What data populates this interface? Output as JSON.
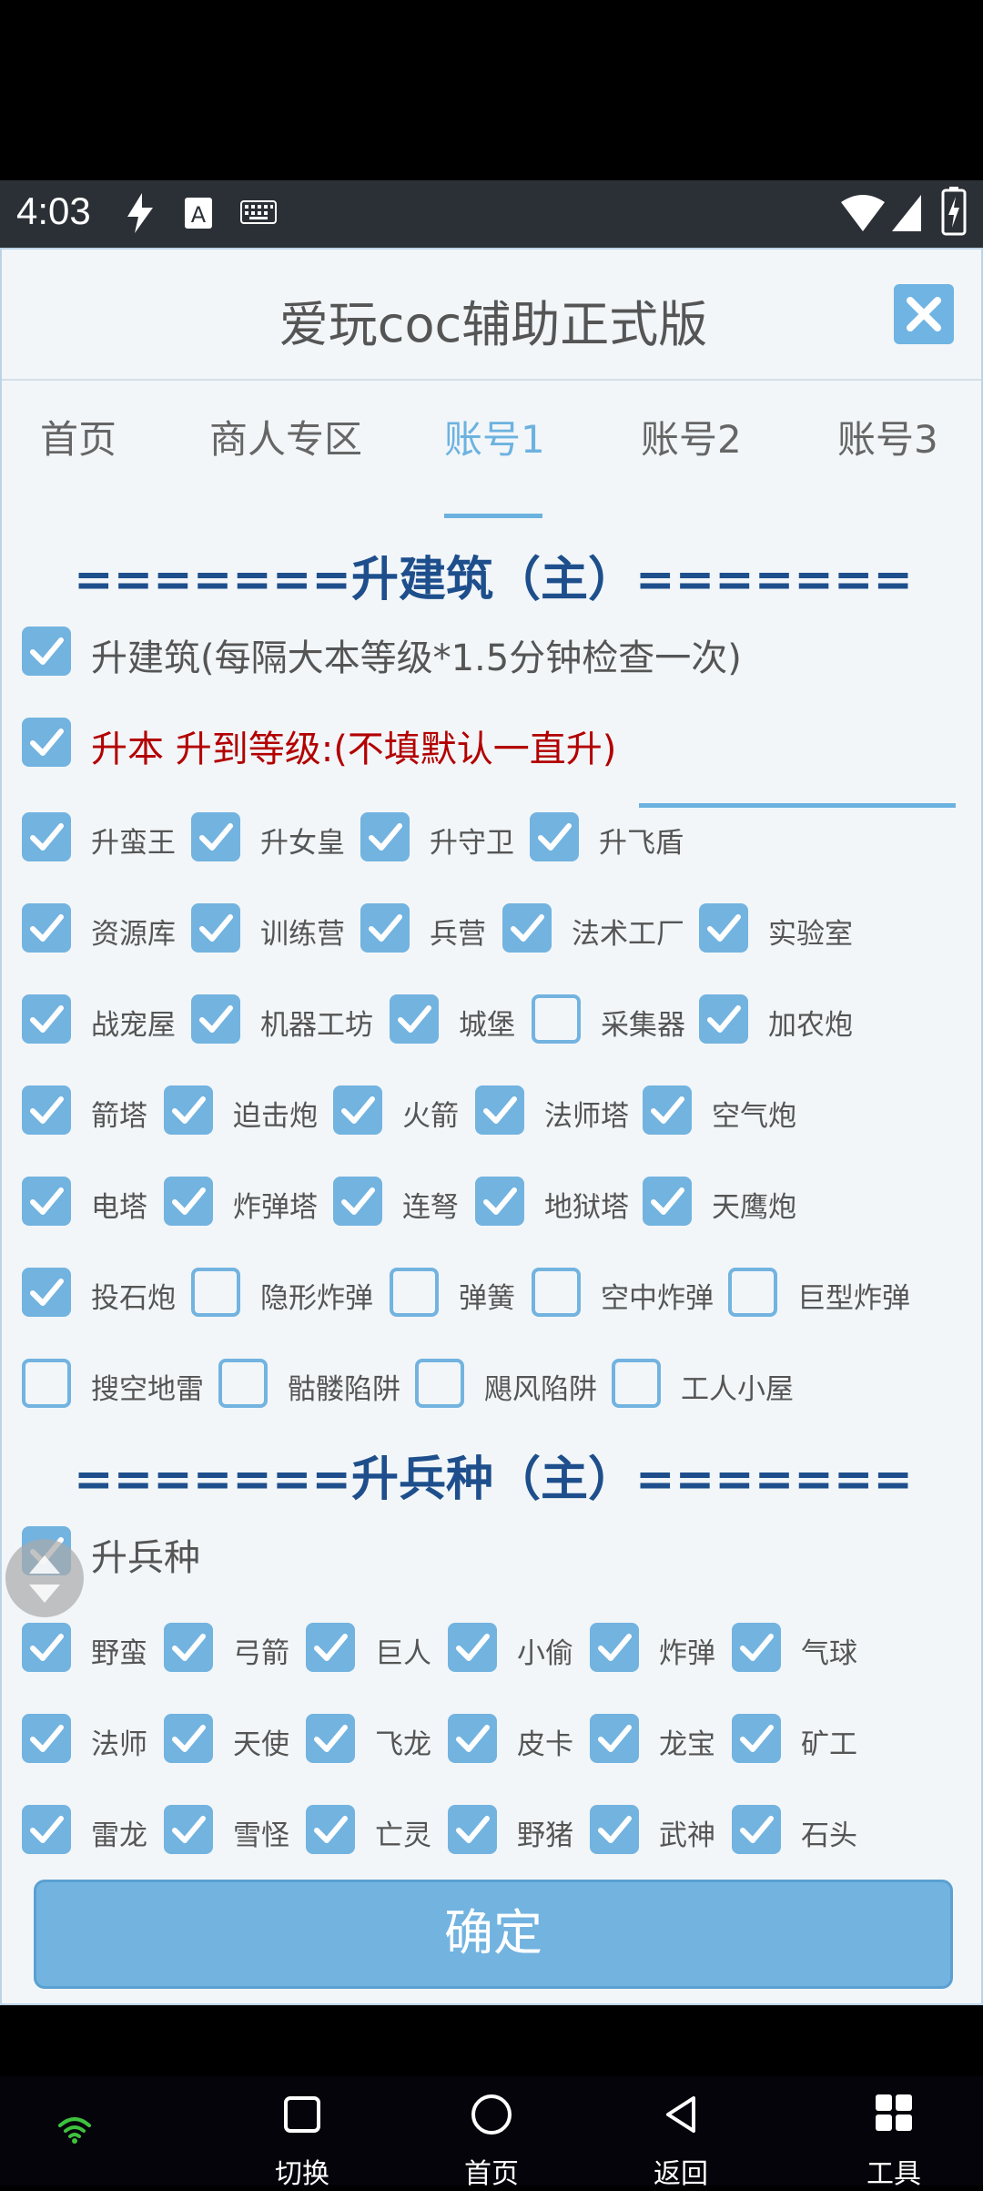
{
  "status_bar": {
    "time": "4:03"
  },
  "dialog": {
    "title": "爱玩coc辅助正式版"
  },
  "tabs": [
    "首页",
    "商人专区",
    "账号1",
    "账号2",
    "账号3"
  ],
  "active_tab": "账号1",
  "section_building": {
    "header": "=======升建筑（主）=======",
    "upgrade_building_label": "升建筑(每隔大本等级*1.5分钟检查一次)",
    "upgrade_townhall_label": "升本 升到等级:(不填默认一直升)",
    "level_input_value": "",
    "rows": [
      [
        {
          "label": "升蛮王",
          "checked": true
        },
        {
          "label": "升女皇",
          "checked": true
        },
        {
          "label": "升守卫",
          "checked": true
        },
        {
          "label": "升飞盾",
          "checked": true
        }
      ],
      [
        {
          "label": "资源库",
          "checked": true
        },
        {
          "label": "训练营",
          "checked": true
        },
        {
          "label": "兵营",
          "checked": true
        },
        {
          "label": "法术工厂",
          "checked": true
        },
        {
          "label": "实验室",
          "checked": true
        }
      ],
      [
        {
          "label": "战宠屋",
          "checked": true
        },
        {
          "label": "机器工坊",
          "checked": true
        },
        {
          "label": "城堡",
          "checked": true
        },
        {
          "label": "采集器",
          "checked": false
        },
        {
          "label": "加农炮",
          "checked": true
        }
      ],
      [
        {
          "label": "箭塔",
          "checked": true
        },
        {
          "label": "迫击炮",
          "checked": true
        },
        {
          "label": "火箭",
          "checked": true
        },
        {
          "label": "法师塔",
          "checked": true
        },
        {
          "label": "空气炮",
          "checked": true
        }
      ],
      [
        {
          "label": "电塔",
          "checked": true
        },
        {
          "label": "炸弹塔",
          "checked": true
        },
        {
          "label": "连弩",
          "checked": true
        },
        {
          "label": "地狱塔",
          "checked": true
        },
        {
          "label": "天鹰炮",
          "checked": true
        }
      ],
      [
        {
          "label": "投石炮",
          "checked": true
        },
        {
          "label": "隐形炸弹",
          "checked": false
        },
        {
          "label": "弹簧",
          "checked": false
        },
        {
          "label": "空中炸弹",
          "checked": false
        },
        {
          "label": "巨型炸弹",
          "checked": false
        }
      ],
      [
        {
          "label": "搜空地雷",
          "checked": false
        },
        {
          "label": "骷髅陷阱",
          "checked": false
        },
        {
          "label": "飓风陷阱",
          "checked": false
        },
        {
          "label": "工人小屋",
          "checked": false
        }
      ]
    ]
  },
  "section_troops": {
    "header": "=======升兵种（主）=======",
    "upgrade_troops_label": "升兵种",
    "rows": [
      [
        {
          "label": "野蛮",
          "checked": true
        },
        {
          "label": "弓箭",
          "checked": true
        },
        {
          "label": "巨人",
          "checked": true
        },
        {
          "label": "小偷",
          "checked": true
        },
        {
          "label": "炸弹",
          "checked": true
        },
        {
          "label": "气球",
          "checked": true
        }
      ],
      [
        {
          "label": "法师",
          "checked": true
        },
        {
          "label": "天使",
          "checked": true
        },
        {
          "label": "飞龙",
          "checked": true
        },
        {
          "label": "皮卡",
          "checked": true
        },
        {
          "label": "龙宝",
          "checked": true
        },
        {
          "label": "矿工",
          "checked": true
        }
      ],
      [
        {
          "label": "雷龙",
          "checked": true
        },
        {
          "label": "雪怪",
          "checked": true
        },
        {
          "label": "亡灵",
          "checked": true
        },
        {
          "label": "野猪",
          "checked": true
        },
        {
          "label": "武神",
          "checked": true
        },
        {
          "label": "石头",
          "checked": true
        }
      ]
    ]
  },
  "confirm_label": "确定",
  "nav": [
    {
      "label": "切换",
      "icon": "square-icon"
    },
    {
      "label": "首页",
      "icon": "circle-icon"
    },
    {
      "label": "返回",
      "icon": "back-triangle-icon"
    },
    {
      "label": "工具",
      "icon": "grid-icon"
    }
  ],
  "colors": {
    "accent": "#6cb2e0",
    "header": "#1e4f8c",
    "warning": "#b30000"
  }
}
